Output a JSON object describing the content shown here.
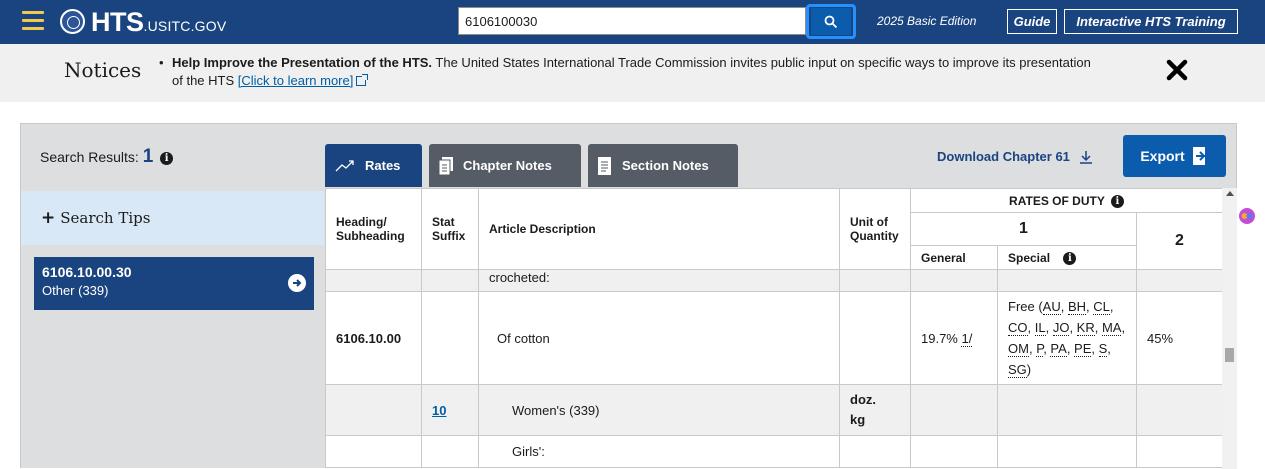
{
  "header": {
    "logo_main": "HTS",
    "logo_sub": ".USITC.GOV",
    "search_value": "6106100030",
    "edition": "2025 Basic Edition",
    "guide_label": "Guide",
    "training_label": "Interactive HTS Training",
    "icons": [
      "menu-icon",
      "seal-icon",
      "search-icon"
    ],
    "accent_color": "#1a4480"
  },
  "notices": {
    "title": "Notices",
    "bold_text": "Help Improve the Presentation of the HTS.",
    "text_line1": " The United States International Trade Commission invites public input on specific ways to improve its presentation",
    "text_line2": "of the HTS ",
    "link_text": "[Click to learn more]"
  },
  "results": {
    "label": "Search Results: ",
    "count": "1",
    "tabs": [
      {
        "label": "Rates",
        "icon": "trend-chart-icon",
        "active": true
      },
      {
        "label": "Chapter Notes",
        "icon": "document-icon",
        "active": false
      },
      {
        "label": "Section Notes",
        "icon": "document-icon",
        "active": false
      }
    ],
    "download_label": "Download Chapter 61",
    "export_label": "Export"
  },
  "sidebar": {
    "search_tips_label": "Search Tips",
    "items": [
      {
        "code": "6106.10.00.30",
        "desc": "Other (339)"
      }
    ]
  },
  "table": {
    "headers": {
      "heading": "Heading/ Subheading",
      "stat": "Stat Suffix",
      "article": "Article Description",
      "unit": "Unit of Quantity",
      "rates_of_duty": "RATES OF DUTY",
      "col1": "1",
      "col2": "2",
      "general": "General",
      "special": "Special"
    },
    "rows": [
      {
        "heading": "",
        "stat": "",
        "desc": "crocheted:",
        "unit": "",
        "general": "",
        "special": "",
        "col2": ""
      },
      {
        "heading": "6106.10.00",
        "stat": "",
        "desc": "Of cotton",
        "unit": "",
        "general_rate": "19.7% ",
        "general_note": "1/",
        "special_prefix": "Free (",
        "special_codes": [
          "AU",
          "BH",
          "CL",
          "CO",
          "IL",
          "JO",
          "KR",
          "MA",
          "OM",
          "P",
          "PA",
          "PE",
          "S",
          "SG"
        ],
        "col2": "45%"
      },
      {
        "heading": "",
        "stat": "10",
        "desc": "Women's (339)",
        "unit_line1": "doz.",
        "unit_line2": "kg"
      },
      {
        "heading": "",
        "stat": "",
        "desc": "Girls':"
      }
    ]
  }
}
